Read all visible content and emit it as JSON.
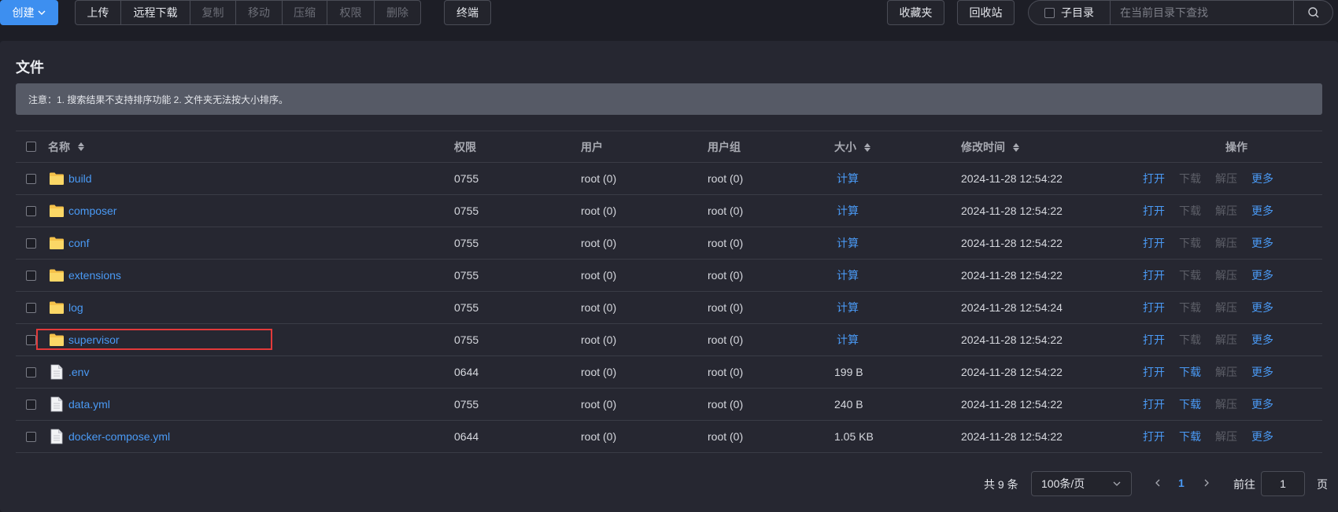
{
  "toolbar": {
    "create_label": "创建",
    "group": [
      {
        "label": "上传",
        "disabled": false
      },
      {
        "label": "远程下载",
        "disabled": false
      },
      {
        "label": "复制",
        "disabled": true
      },
      {
        "label": "移动",
        "disabled": true
      },
      {
        "label": "压缩",
        "disabled": true
      },
      {
        "label": "权限",
        "disabled": true
      },
      {
        "label": "删除",
        "disabled": true
      }
    ],
    "terminal_label": "终端",
    "favorites_label": "收藏夹",
    "recycle_label": "回收站",
    "subdir_label": "子目录",
    "search_placeholder": "在当前目录下查找"
  },
  "panel": {
    "title": "文件",
    "notice": "注意：1. 搜索结果不支持排序功能 2. 文件夹无法按大小排序。"
  },
  "table": {
    "headers": {
      "name": "名称",
      "perm": "权限",
      "user": "用户",
      "group": "用户组",
      "size": "大小",
      "mtime": "修改时间",
      "ops": "操作"
    },
    "rows": [
      {
        "name": "build",
        "type": "folder",
        "perm": "0755",
        "user": "root (0)",
        "group": "root (0)",
        "size": "计算",
        "mtime": "2024-11-28 12:54:22",
        "open": "打开",
        "download": "下载",
        "extract": "解压",
        "more": "更多",
        "download_enabled": false
      },
      {
        "name": "composer",
        "type": "folder",
        "perm": "0755",
        "user": "root (0)",
        "group": "root (0)",
        "size": "计算",
        "mtime": "2024-11-28 12:54:22",
        "open": "打开",
        "download": "下载",
        "extract": "解压",
        "more": "更多",
        "download_enabled": false
      },
      {
        "name": "conf",
        "type": "folder",
        "perm": "0755",
        "user": "root (0)",
        "group": "root (0)",
        "size": "计算",
        "mtime": "2024-11-28 12:54:22",
        "open": "打开",
        "download": "下载",
        "extract": "解压",
        "more": "更多",
        "download_enabled": false
      },
      {
        "name": "extensions",
        "type": "folder",
        "perm": "0755",
        "user": "root (0)",
        "group": "root (0)",
        "size": "计算",
        "mtime": "2024-11-28 12:54:22",
        "open": "打开",
        "download": "下载",
        "extract": "解压",
        "more": "更多",
        "download_enabled": false
      },
      {
        "name": "log",
        "type": "folder",
        "perm": "0755",
        "user": "root (0)",
        "group": "root (0)",
        "size": "计算",
        "mtime": "2024-11-28 12:54:24",
        "open": "打开",
        "download": "下载",
        "extract": "解压",
        "more": "更多",
        "download_enabled": false
      },
      {
        "name": "supervisor",
        "type": "folder",
        "perm": "0755",
        "user": "root (0)",
        "group": "root (0)",
        "size": "计算",
        "mtime": "2024-11-28 12:54:22",
        "open": "打开",
        "download": "下载",
        "extract": "解压",
        "more": "更多",
        "download_enabled": false,
        "highlighted": true
      },
      {
        "name": ".env",
        "type": "file",
        "perm": "0644",
        "user": "root (0)",
        "group": "root (0)",
        "size": "199 B",
        "mtime": "2024-11-28 12:54:22",
        "open": "打开",
        "download": "下载",
        "extract": "解压",
        "more": "更多",
        "download_enabled": true
      },
      {
        "name": "data.yml",
        "type": "file",
        "perm": "0755",
        "user": "root (0)",
        "group": "root (0)",
        "size": "240 B",
        "mtime": "2024-11-28 12:54:22",
        "open": "打开",
        "download": "下载",
        "extract": "解压",
        "more": "更多",
        "download_enabled": true
      },
      {
        "name": "docker-compose.yml",
        "type": "file",
        "perm": "0644",
        "user": "root (0)",
        "group": "root (0)",
        "size": "1.05 KB",
        "mtime": "2024-11-28 12:54:22",
        "open": "打开",
        "download": "下载",
        "extract": "解压",
        "more": "更多",
        "download_enabled": true
      }
    ]
  },
  "pager": {
    "total": "共 9 条",
    "page_size": "100条/页",
    "current_page": "1",
    "goto_label": "前往",
    "goto_value": "1",
    "page_label": "页"
  },
  "colors": {
    "accent": "#4a9af5",
    "primary_button": "#3d8ff0",
    "folder": "#f5c24a",
    "highlight": "#e23a3a"
  }
}
